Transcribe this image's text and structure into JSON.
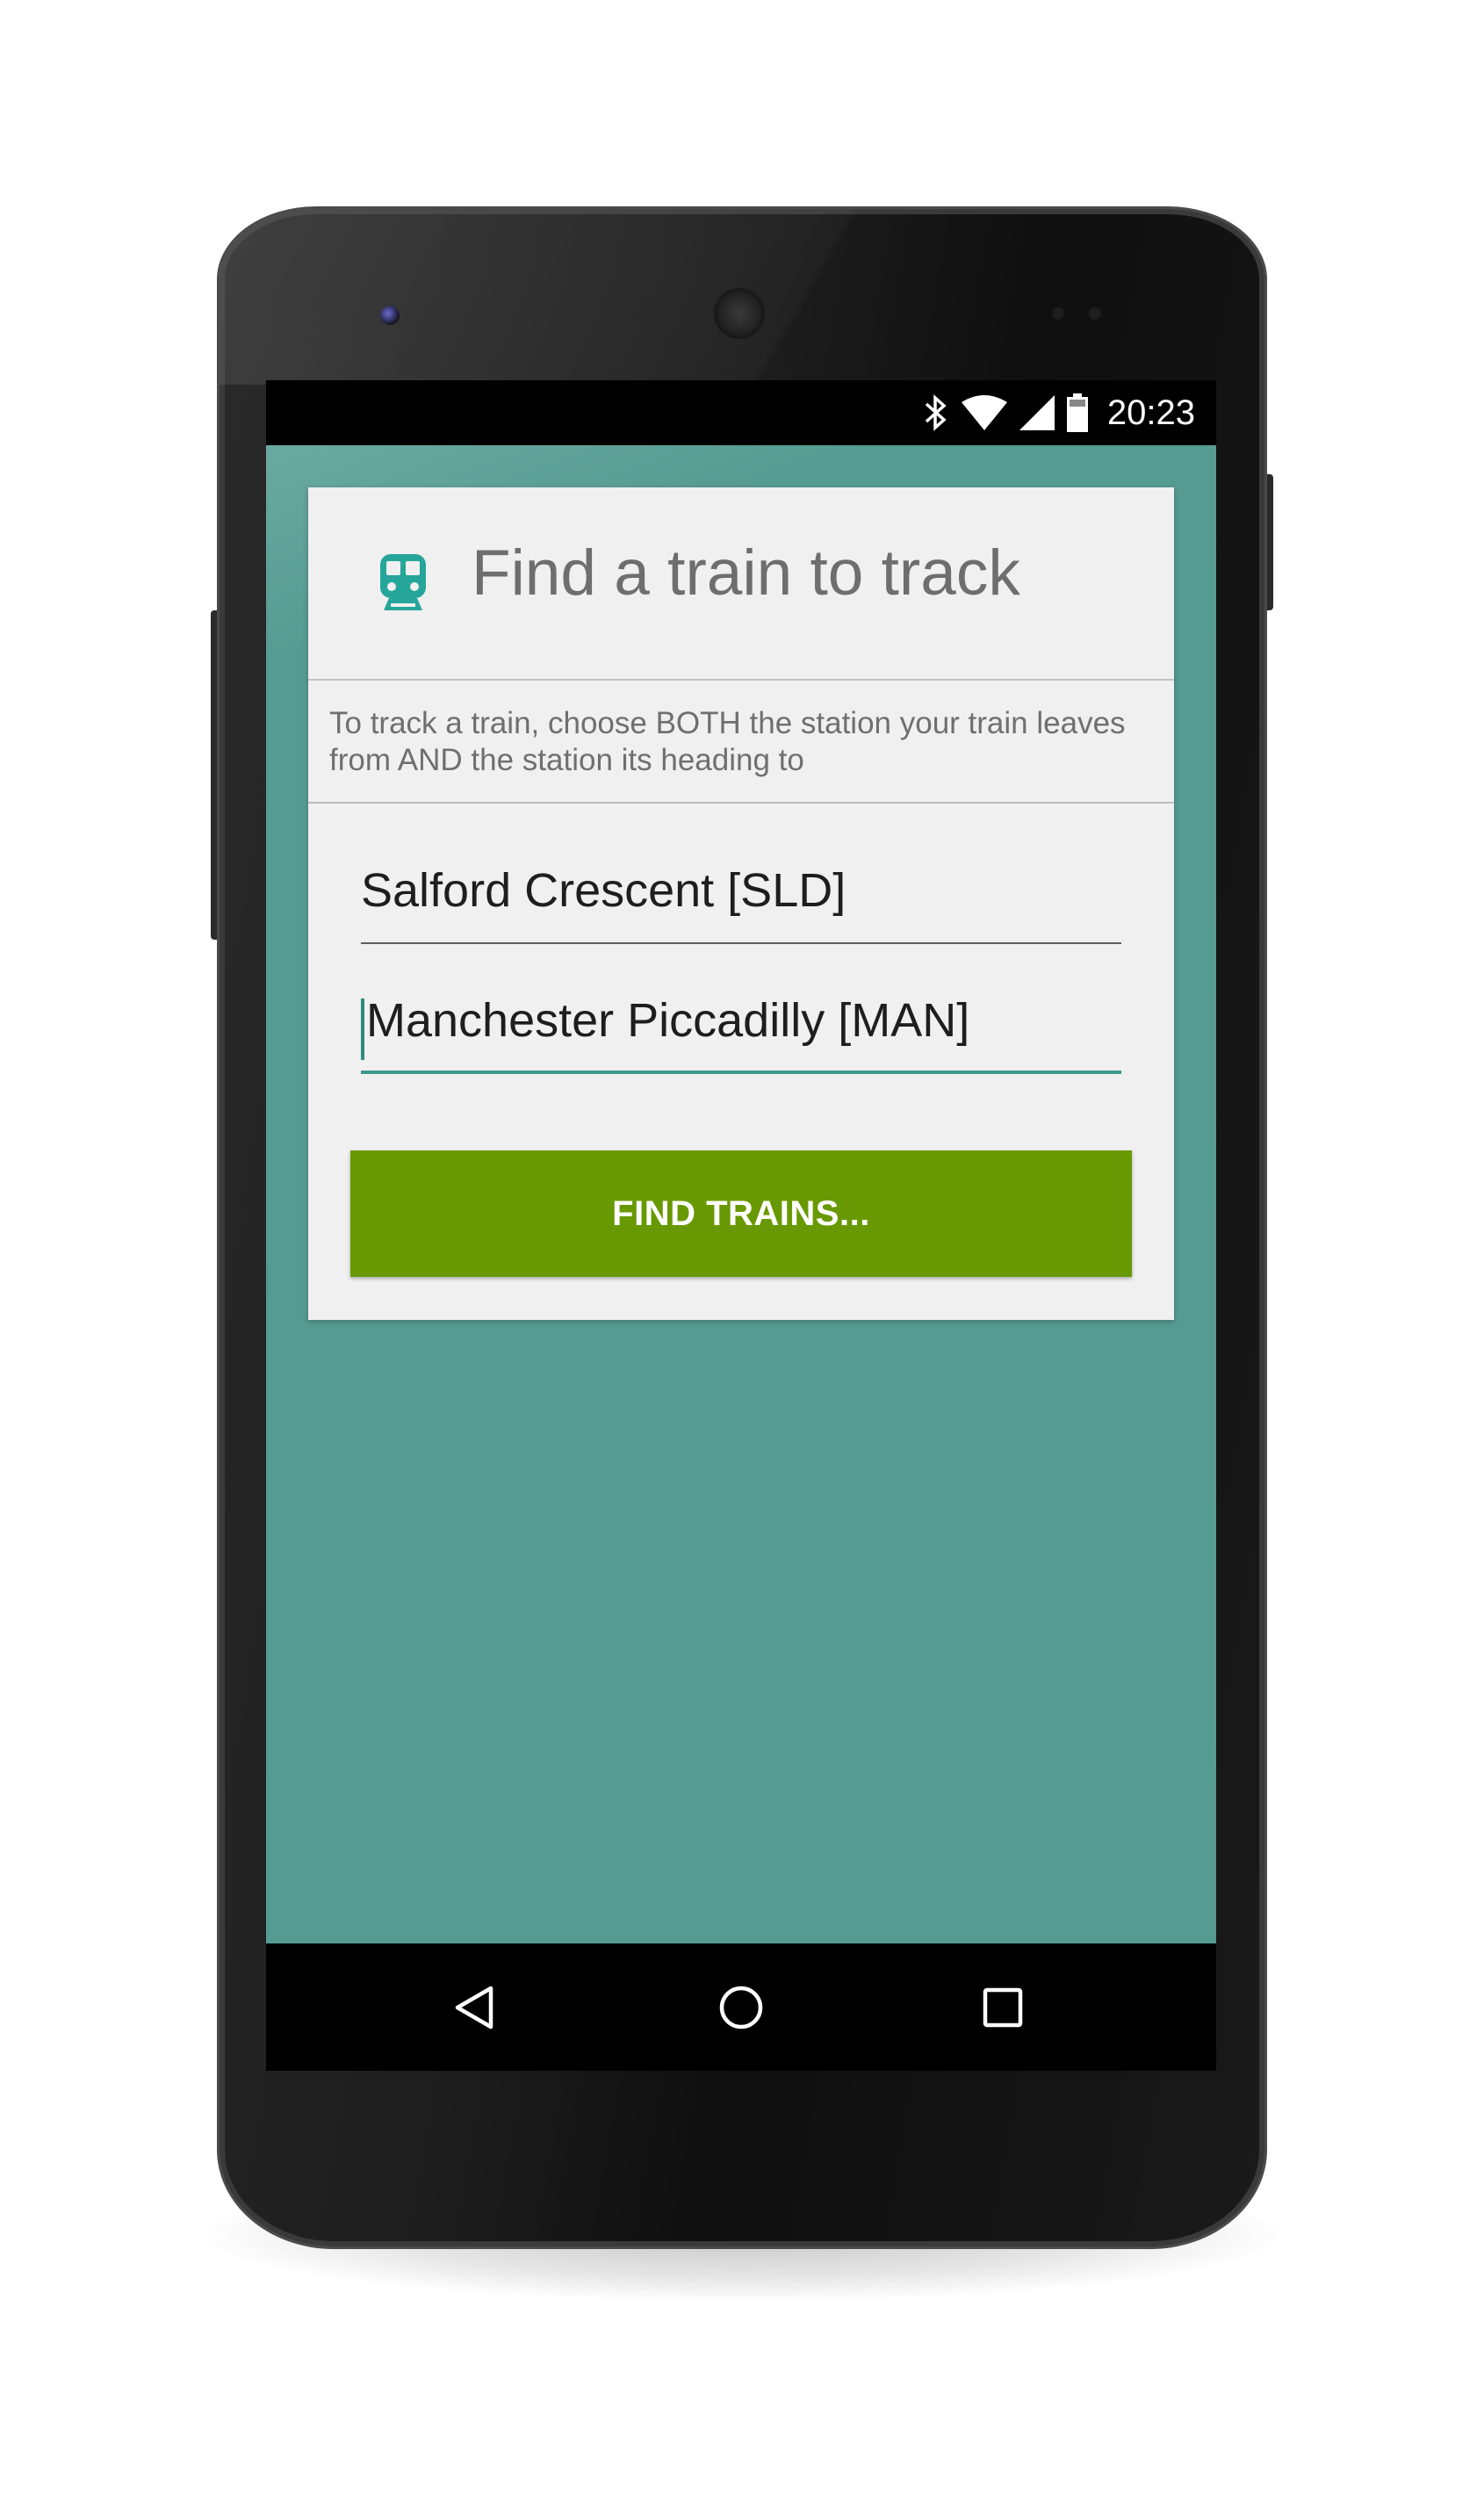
{
  "status_bar": {
    "time": "20:23",
    "icons": [
      "bluetooth-icon",
      "wifi-icon",
      "signal-icon",
      "battery-icon"
    ]
  },
  "dialog": {
    "title": "Find a train to track",
    "icon": "train-icon",
    "instructions": "To track a train, choose BOTH the station your train leaves from AND the station its heading to",
    "origin_field": {
      "value": "Salford Crescent [SLD]"
    },
    "destination_field": {
      "value": "Manchester Piccadilly [MAN]",
      "focused": true
    },
    "find_button_label": "FIND TRAINS..."
  },
  "nav_bar": {
    "buttons": [
      "back-icon",
      "home-icon",
      "recents-icon"
    ]
  },
  "colors": {
    "background": "#569b91",
    "button": "#689902",
    "accent": "#2e8b7f",
    "train_icon": "#26a69a",
    "dialog": "#f0f0f0"
  }
}
